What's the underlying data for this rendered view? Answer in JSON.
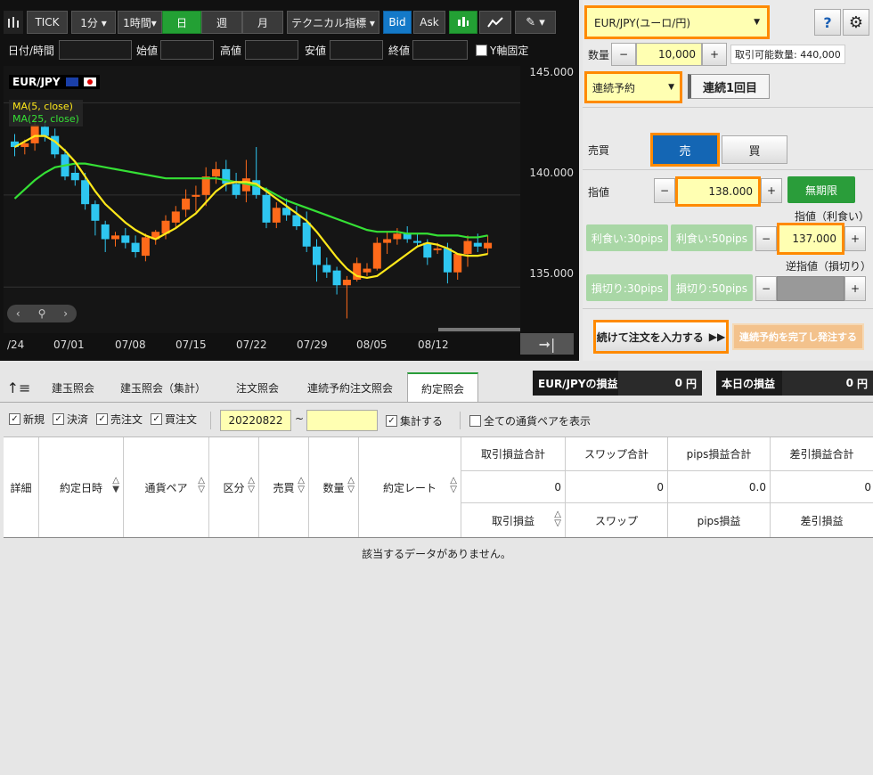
{
  "toolbar": {
    "tick": "TICK",
    "interval": "1分 ▾",
    "period": "1時間▾",
    "day": "日",
    "week": "週",
    "month": "月",
    "technical": "テクニカル指標 ▾",
    "bid": "Bid",
    "ask": "Ask"
  },
  "ohlc": {
    "datetime": "日付/時間",
    "open": "始値",
    "high": "高値",
    "low": "安値",
    "close": "終値",
    "yfix": "Y軸固定"
  },
  "chart_data": {
    "type": "candlestick",
    "title": "EUR/JPY",
    "legend": [
      "MA(5, close)",
      "MA(25, close)"
    ],
    "ylim": [
      132.5,
      147
    ],
    "yticks": [
      "145.000",
      "140.000",
      "135.000"
    ],
    "xticks": [
      "/24",
      "07/01",
      "07/08",
      "07/15",
      "07/22",
      "07/29",
      "08/05",
      "08/12"
    ],
    "candles": [
      [
        142.9,
        143.3,
        142.1,
        142.6
      ],
      [
        142.6,
        143.0,
        142.2,
        142.8
      ],
      [
        142.8,
        144.2,
        142.4,
        143.8
      ],
      [
        143.7,
        144.0,
        142.9,
        143.2
      ],
      [
        143.2,
        143.6,
        142.0,
        142.2
      ],
      [
        142.2,
        142.5,
        140.8,
        141.0
      ],
      [
        141.2,
        141.6,
        140.5,
        140.8
      ],
      [
        140.8,
        141.2,
        139.2,
        139.5
      ],
      [
        139.5,
        139.7,
        137.8,
        138.6
      ],
      [
        138.4,
        138.6,
        136.9,
        137.6
      ],
      [
        137.6,
        138.0,
        137.2,
        137.8
      ],
      [
        137.8,
        138.2,
        137.1,
        137.4
      ],
      [
        137.4,
        137.8,
        136.6,
        136.9
      ],
      [
        136.7,
        137.9,
        136.4,
        137.7
      ],
      [
        137.6,
        138.1,
        137.3,
        138.0
      ],
      [
        137.9,
        138.9,
        137.6,
        138.6
      ],
      [
        138.5,
        139.4,
        138.2,
        139.1
      ],
      [
        139.2,
        140.3,
        138.8,
        139.8
      ],
      [
        139.9,
        140.5,
        139.1,
        140.0
      ],
      [
        140.0,
        141.5,
        139.4,
        141.0
      ],
      [
        141.0,
        141.8,
        140.6,
        141.4
      ],
      [
        141.4,
        141.9,
        140.2,
        140.6
      ],
      [
        140.6,
        141.2,
        139.8,
        140.0
      ],
      [
        140.2,
        141.9,
        139.6,
        140.9
      ],
      [
        140.8,
        142.6,
        139.8,
        140.0
      ],
      [
        140.0,
        140.4,
        138.2,
        138.5
      ],
      [
        138.5,
        139.6,
        138.2,
        139.3
      ],
      [
        139.3,
        139.8,
        138.6,
        138.9
      ],
      [
        138.9,
        139.4,
        138.1,
        138.3
      ],
      [
        138.5,
        139.1,
        136.9,
        137.2
      ],
      [
        137.2,
        137.6,
        135.3,
        136.2
      ],
      [
        136.2,
        136.6,
        135.5,
        135.8
      ],
      [
        135.9,
        136.1,
        134.6,
        135.1
      ],
      [
        135.1,
        135.6,
        133.3,
        135.4
      ],
      [
        135.4,
        136.6,
        135.3,
        136.3
      ],
      [
        135.8,
        136.3,
        135.6,
        136.0
      ],
      [
        136.0,
        137.7,
        135.9,
        137.4
      ],
      [
        137.4,
        138.0,
        136.8,
        137.6
      ],
      [
        137.6,
        138.2,
        137.3,
        137.9
      ],
      [
        137.9,
        138.3,
        137.4,
        137.6
      ],
      [
        137.5,
        137.9,
        137.2,
        137.4
      ],
      [
        137.4,
        137.6,
        136.2,
        136.6
      ],
      [
        137.0,
        137.4,
        136.8,
        137.1
      ],
      [
        137.1,
        137.4,
        135.2,
        135.8
      ],
      [
        135.8,
        136.7,
        135.4,
        136.8
      ],
      [
        136.8,
        137.8,
        136.1,
        137.5
      ],
      [
        137.4,
        137.9,
        136.9,
        137.2
      ],
      [
        137.1,
        137.8,
        136.8,
        137.4
      ]
    ],
    "ma5": [
      142.6,
      142.9,
      143.2,
      143.2,
      142.9,
      142.4,
      141.8,
      141.0,
      140.2,
      139.5,
      139.0,
      138.5,
      138.1,
      137.8,
      137.6,
      137.9,
      138.2,
      138.6,
      139.0,
      139.6,
      140.2,
      140.6,
      140.7,
      140.7,
      140.6,
      140.2,
      139.8,
      139.4,
      139.0,
      138.6,
      138.0,
      137.3,
      136.6,
      136.0,
      135.6,
      135.5,
      135.6,
      136.0,
      136.4,
      136.8,
      137.2,
      137.4,
      137.3,
      137.1,
      136.8,
      136.7,
      136.7,
      136.8
    ],
    "ma25": [
      139.8,
      140.3,
      140.8,
      141.2,
      141.5,
      141.6,
      141.7,
      141.7,
      141.6,
      141.5,
      141.4,
      141.3,
      141.2,
      141.1,
      141.0,
      140.9,
      140.9,
      140.9,
      140.9,
      140.9,
      140.9,
      140.8,
      140.7,
      140.6,
      140.5,
      140.3,
      140.0,
      139.7,
      139.5,
      139.3,
      139.1,
      138.9,
      138.7,
      138.5,
      138.3,
      138.1,
      138.0,
      138.0,
      138.0,
      137.9,
      137.9,
      137.9,
      137.8,
      137.8,
      137.8,
      137.7,
      137.7,
      137.8
    ]
  },
  "order": {
    "pair": "EUR/JPY(ユーロ/円)",
    "qty_label": "数量",
    "qty": "10,000",
    "avail": "取引可能数量: 440,000",
    "type": "連続予約",
    "seq": "連続1回目",
    "side_label": "売買",
    "sell": "売",
    "buy": "買",
    "limit_label": "指値",
    "limit_value": "138.000",
    "expiry": "無期限",
    "tp_caption": "指値（利食い）",
    "tp30": "利食い:30pips",
    "tp50": "利食い:50pips",
    "tp_value": "137.000",
    "sl_caption": "逆指値（損切り）",
    "sl30": "損切り:30pips",
    "sl50": "損切り:50pips",
    "continue": "続けて注文を入力する",
    "complete": "連続予約を完了し発注する",
    "minus": "−",
    "plus": "+"
  },
  "tabs": [
    "建玉照会",
    "建玉照会（集計）",
    "注文照会",
    "連続予約注文照会",
    "約定照会"
  ],
  "pl": {
    "pair_label": "EUR/JPYの損益",
    "pair_value": "0",
    "today_label": "本日の損益",
    "today_value": "0",
    "unit": "円"
  },
  "filters": {
    "new": "新規",
    "settle": "決済",
    "sell": "売注文",
    "buy": "買注文",
    "from": "20220822",
    "tilde": "~",
    "aggregate": "集計する",
    "all_pairs": "全ての通貨ペアを表示"
  },
  "grid": {
    "cols": [
      "詳細",
      "約定日時",
      "通貨ペア",
      "区分",
      "売買",
      "数量",
      "約定レート"
    ],
    "sum_headers": [
      "取引損益合計",
      "スワップ合計",
      "pips損益合計",
      "差引損益合計"
    ],
    "sum_values": [
      "0",
      "0",
      "0.0",
      "0"
    ],
    "sub_headers": [
      "取引損益",
      "スワップ",
      "pips損益",
      "差引損益"
    ],
    "empty": "該当するデータがありません。"
  }
}
